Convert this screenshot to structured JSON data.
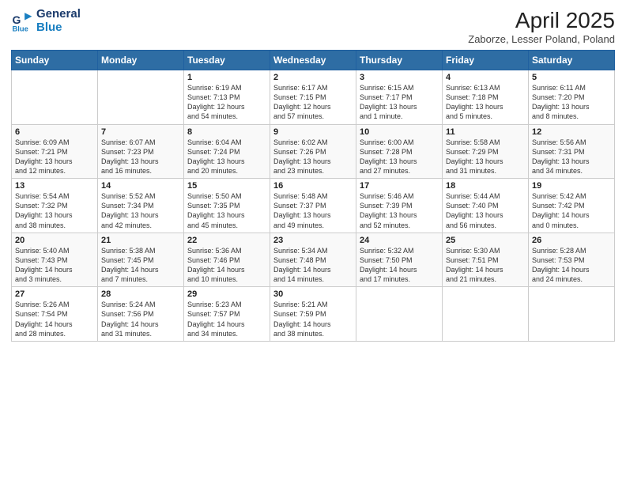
{
  "header": {
    "logo_line1": "General",
    "logo_line2": "Blue",
    "main_title": "April 2025",
    "subtitle": "Zaborze, Lesser Poland, Poland"
  },
  "weekdays": [
    "Sunday",
    "Monday",
    "Tuesday",
    "Wednesday",
    "Thursday",
    "Friday",
    "Saturday"
  ],
  "weeks": [
    [
      {
        "day": "",
        "info": ""
      },
      {
        "day": "",
        "info": ""
      },
      {
        "day": "1",
        "info": "Sunrise: 6:19 AM\nSunset: 7:13 PM\nDaylight: 12 hours\nand 54 minutes."
      },
      {
        "day": "2",
        "info": "Sunrise: 6:17 AM\nSunset: 7:15 PM\nDaylight: 12 hours\nand 57 minutes."
      },
      {
        "day": "3",
        "info": "Sunrise: 6:15 AM\nSunset: 7:17 PM\nDaylight: 13 hours\nand 1 minute."
      },
      {
        "day": "4",
        "info": "Sunrise: 6:13 AM\nSunset: 7:18 PM\nDaylight: 13 hours\nand 5 minutes."
      },
      {
        "day": "5",
        "info": "Sunrise: 6:11 AM\nSunset: 7:20 PM\nDaylight: 13 hours\nand 8 minutes."
      }
    ],
    [
      {
        "day": "6",
        "info": "Sunrise: 6:09 AM\nSunset: 7:21 PM\nDaylight: 13 hours\nand 12 minutes."
      },
      {
        "day": "7",
        "info": "Sunrise: 6:07 AM\nSunset: 7:23 PM\nDaylight: 13 hours\nand 16 minutes."
      },
      {
        "day": "8",
        "info": "Sunrise: 6:04 AM\nSunset: 7:24 PM\nDaylight: 13 hours\nand 20 minutes."
      },
      {
        "day": "9",
        "info": "Sunrise: 6:02 AM\nSunset: 7:26 PM\nDaylight: 13 hours\nand 23 minutes."
      },
      {
        "day": "10",
        "info": "Sunrise: 6:00 AM\nSunset: 7:28 PM\nDaylight: 13 hours\nand 27 minutes."
      },
      {
        "day": "11",
        "info": "Sunrise: 5:58 AM\nSunset: 7:29 PM\nDaylight: 13 hours\nand 31 minutes."
      },
      {
        "day": "12",
        "info": "Sunrise: 5:56 AM\nSunset: 7:31 PM\nDaylight: 13 hours\nand 34 minutes."
      }
    ],
    [
      {
        "day": "13",
        "info": "Sunrise: 5:54 AM\nSunset: 7:32 PM\nDaylight: 13 hours\nand 38 minutes."
      },
      {
        "day": "14",
        "info": "Sunrise: 5:52 AM\nSunset: 7:34 PM\nDaylight: 13 hours\nand 42 minutes."
      },
      {
        "day": "15",
        "info": "Sunrise: 5:50 AM\nSunset: 7:35 PM\nDaylight: 13 hours\nand 45 minutes."
      },
      {
        "day": "16",
        "info": "Sunrise: 5:48 AM\nSunset: 7:37 PM\nDaylight: 13 hours\nand 49 minutes."
      },
      {
        "day": "17",
        "info": "Sunrise: 5:46 AM\nSunset: 7:39 PM\nDaylight: 13 hours\nand 52 minutes."
      },
      {
        "day": "18",
        "info": "Sunrise: 5:44 AM\nSunset: 7:40 PM\nDaylight: 13 hours\nand 56 minutes."
      },
      {
        "day": "19",
        "info": "Sunrise: 5:42 AM\nSunset: 7:42 PM\nDaylight: 14 hours\nand 0 minutes."
      }
    ],
    [
      {
        "day": "20",
        "info": "Sunrise: 5:40 AM\nSunset: 7:43 PM\nDaylight: 14 hours\nand 3 minutes."
      },
      {
        "day": "21",
        "info": "Sunrise: 5:38 AM\nSunset: 7:45 PM\nDaylight: 14 hours\nand 7 minutes."
      },
      {
        "day": "22",
        "info": "Sunrise: 5:36 AM\nSunset: 7:46 PM\nDaylight: 14 hours\nand 10 minutes."
      },
      {
        "day": "23",
        "info": "Sunrise: 5:34 AM\nSunset: 7:48 PM\nDaylight: 14 hours\nand 14 minutes."
      },
      {
        "day": "24",
        "info": "Sunrise: 5:32 AM\nSunset: 7:50 PM\nDaylight: 14 hours\nand 17 minutes."
      },
      {
        "day": "25",
        "info": "Sunrise: 5:30 AM\nSunset: 7:51 PM\nDaylight: 14 hours\nand 21 minutes."
      },
      {
        "day": "26",
        "info": "Sunrise: 5:28 AM\nSunset: 7:53 PM\nDaylight: 14 hours\nand 24 minutes."
      }
    ],
    [
      {
        "day": "27",
        "info": "Sunrise: 5:26 AM\nSunset: 7:54 PM\nDaylight: 14 hours\nand 28 minutes."
      },
      {
        "day": "28",
        "info": "Sunrise: 5:24 AM\nSunset: 7:56 PM\nDaylight: 14 hours\nand 31 minutes."
      },
      {
        "day": "29",
        "info": "Sunrise: 5:23 AM\nSunset: 7:57 PM\nDaylight: 14 hours\nand 34 minutes."
      },
      {
        "day": "30",
        "info": "Sunrise: 5:21 AM\nSunset: 7:59 PM\nDaylight: 14 hours\nand 38 minutes."
      },
      {
        "day": "",
        "info": ""
      },
      {
        "day": "",
        "info": ""
      },
      {
        "day": "",
        "info": ""
      }
    ]
  ]
}
